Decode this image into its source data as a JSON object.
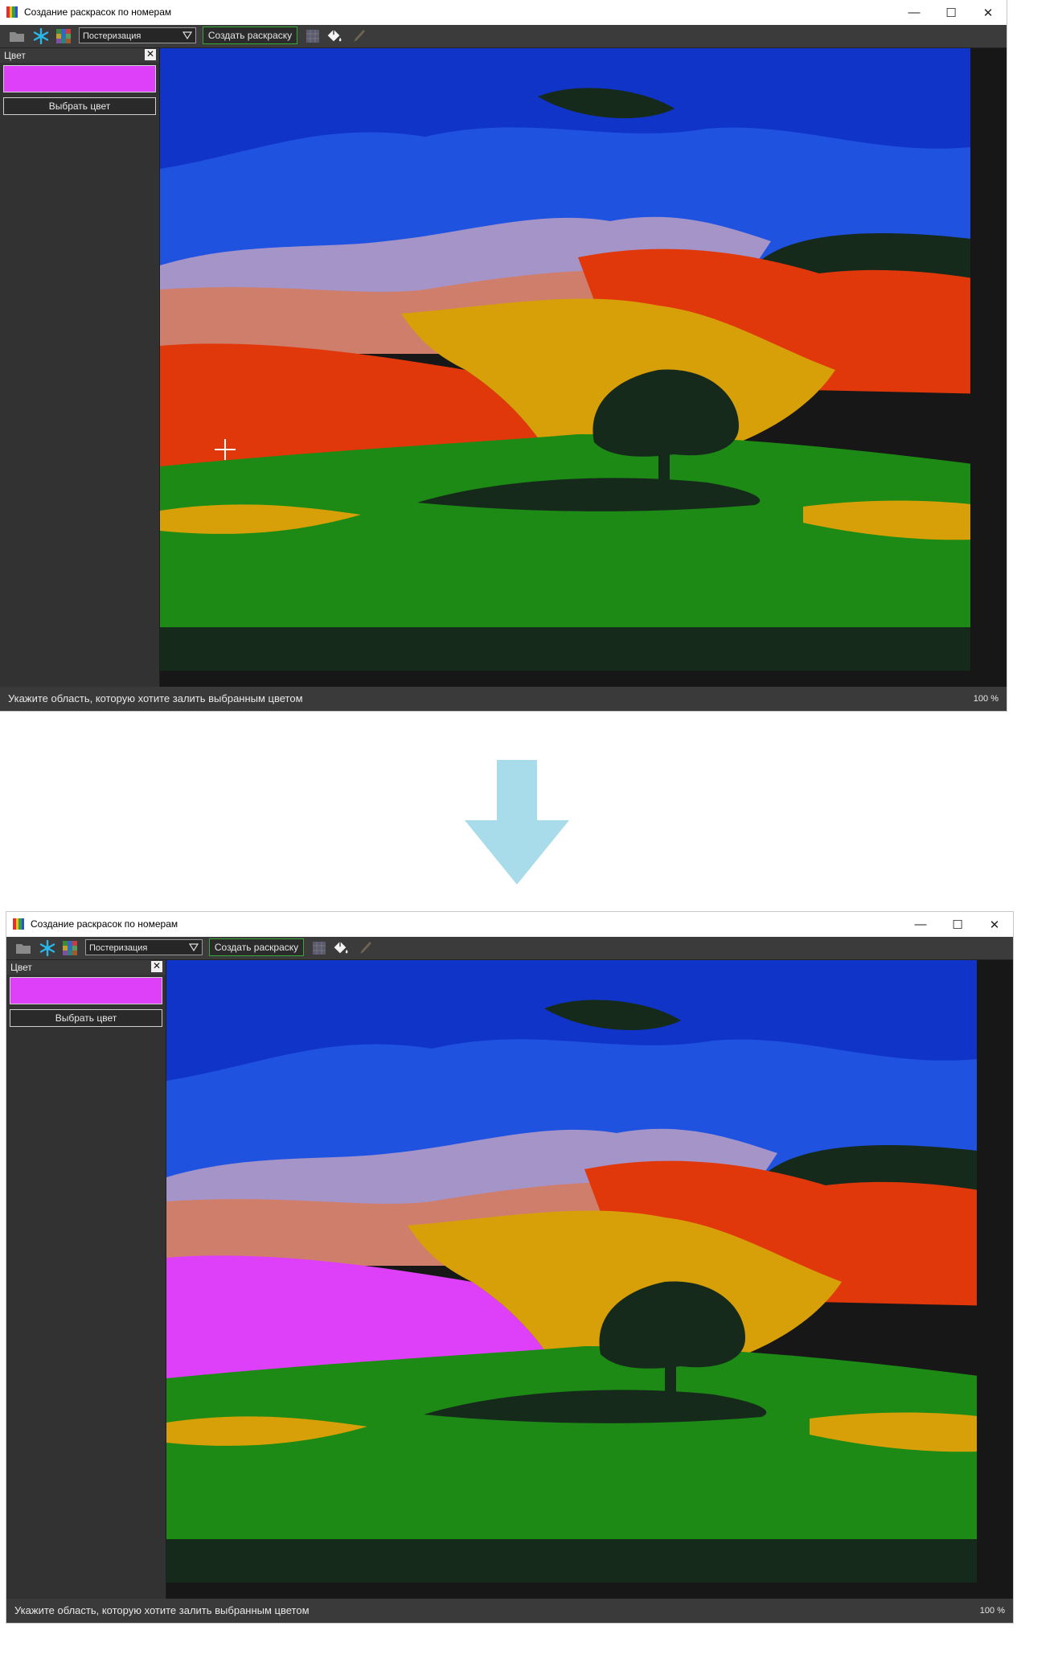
{
  "app": {
    "title": "Создание раскрасок по номерам",
    "window_buttons": {
      "minimize": "—",
      "maximize": "☐",
      "close": "✕"
    }
  },
  "toolbar": {
    "open_icon": "folder-icon",
    "settings_icon": "snowflake-icon",
    "palette_icon": "palette-grid-icon",
    "mode_select": "Постеризация",
    "create_label": "Создать раскраску",
    "numbers_icon": "numbers-grid-icon",
    "fill_icon": "paint-bucket-icon",
    "brush_icon": "brush-icon"
  },
  "sidebar": {
    "header": "Цвет",
    "close_label": "✕",
    "selected_color": "#dd40f8",
    "pick_label": "Выбрать цвет"
  },
  "status": {
    "message": "Укажите область, которую хотите залить выбранным цветом",
    "zoom": "100 %"
  },
  "palette": {
    "deep_blue": "#1034c8",
    "mid_blue": "#2052e0",
    "lavender": "#a494c8",
    "salmon": "#d07e6c",
    "red_orange": "#e0380a",
    "gold": "#d8a008",
    "dark_green": "#162a1c",
    "bright_green": "#1c8a14",
    "magenta_fill": "#dd40f8"
  },
  "screens": [
    {
      "name": "before",
      "filled": false
    },
    {
      "name": "after",
      "filled": true
    }
  ]
}
